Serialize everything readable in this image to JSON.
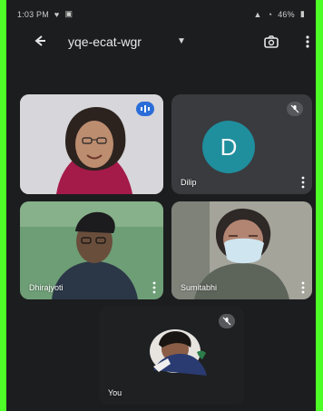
{
  "status_bar": {
    "time": "1:03 PM",
    "right_text": "46%"
  },
  "call_header": {
    "title": "yqe-ecat-wgr"
  },
  "participants": [
    {
      "name": "",
      "state": "speaking",
      "bg": "#d9d7db"
    },
    {
      "name": "Dilip",
      "state": "muted",
      "avatar_letter": "D",
      "avatar_color": "#1f8e9d"
    },
    {
      "name": "Dhirajyoti",
      "state": "video",
      "bg": "#6f9d75"
    },
    {
      "name": "Sumitabhi",
      "state": "video",
      "bg": "#6d7064"
    },
    {
      "name": "You",
      "state": "muted",
      "bg": "#1f2022"
    }
  ],
  "colors": {
    "frame": "#4dff26",
    "app_bg": "#1c1d1f",
    "tile_bg": "#3b3c40",
    "accent_blue": "#2a6dd8"
  }
}
